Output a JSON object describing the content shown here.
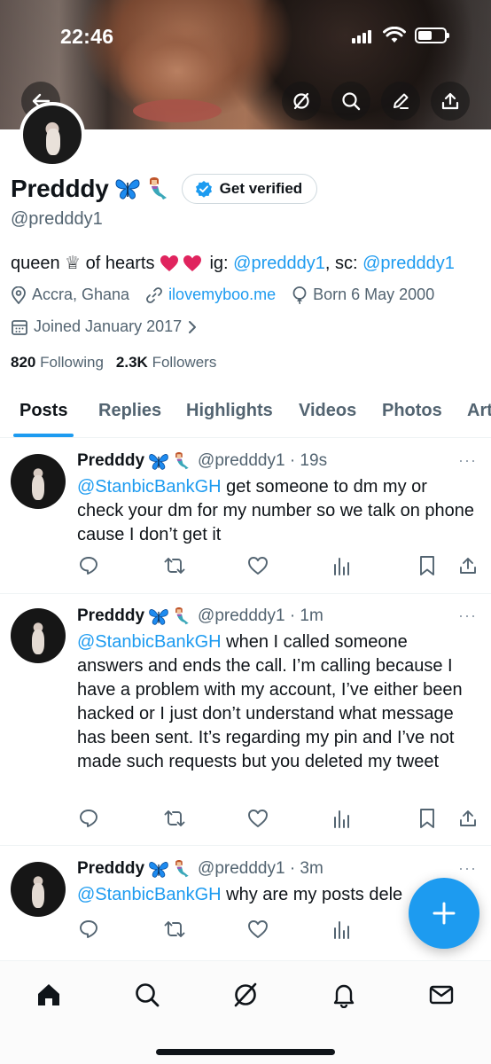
{
  "status_bar": {
    "time": "22:46"
  },
  "header": {
    "back_label": "Back",
    "icons": [
      "back-arrow-icon",
      "grok-icon",
      "search-icon",
      "edit-icon",
      "share-icon"
    ]
  },
  "profile": {
    "display_name": "Predddy",
    "name_emojis": [
      "butterfly",
      "mermaid"
    ],
    "verify_button": "Get verified",
    "handle": "@predddy1",
    "bio": {
      "text_start": "queen ♕ of hearts",
      "ig_label": "ig: ",
      "ig_handle": "@predddy1",
      "sc_label": ", sc: ",
      "sc_handle": "@predddy1"
    },
    "location": "Accra, Ghana",
    "website": "ilovemyboo.me",
    "birthday": "Born 6 May 2000",
    "joined": "Joined January 2017",
    "following_count": "820",
    "following_label": "Following",
    "followers_count": "2.3K",
    "followers_label": "Followers"
  },
  "tabs": [
    {
      "label": "Posts",
      "active": true
    },
    {
      "label": "Replies",
      "active": false
    },
    {
      "label": "Highlights",
      "active": false
    },
    {
      "label": "Videos",
      "active": false
    },
    {
      "label": "Photos",
      "active": false
    },
    {
      "label": "Art",
      "active": false
    }
  ],
  "posts": [
    {
      "name": "Predddy",
      "meta": "@predddy1 · 19s",
      "mention": "@StanbicBankGH",
      "body": " get someone to dm my or check your dm for my number so we talk on phone cause I don’t get it"
    },
    {
      "name": "Predddy",
      "meta": "@predddy1 · 1m",
      "mention": "@StanbicBankGH",
      "body": " when I called someone answers and ends the call. I’m calling because I have a problem with my account, I’ve either been hacked or I just don’t understand what message has been sent. It’s regarding my pin and I’ve not made such requests but you deleted my tweet"
    },
    {
      "name": "Predddy",
      "meta": "@predddy1 · 3m",
      "mention": "@StanbicBankGH",
      "body": " why are my posts dele"
    }
  ],
  "more_label": "···",
  "fab_label": "+",
  "bottom_nav": [
    "home-icon",
    "search-icon",
    "grok-icon",
    "notifications-icon",
    "messages-icon"
  ],
  "colors": {
    "accent": "#1d9bf0",
    "text": "#0f1419",
    "muted": "#536471",
    "divider": "#eff3f4",
    "heart": "#e0245e"
  }
}
